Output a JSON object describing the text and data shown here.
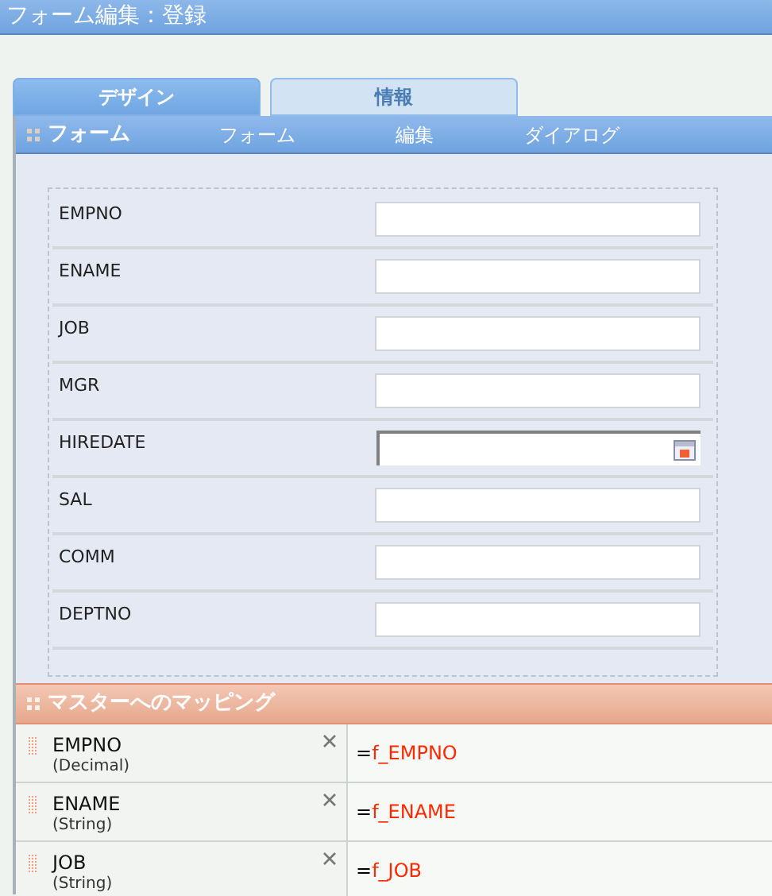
{
  "window": {
    "title": "フォーム編集：登録"
  },
  "tabs": [
    {
      "label": "デザイン",
      "selected": true
    },
    {
      "label": "情報",
      "selected": false
    }
  ],
  "form_panel": {
    "title": "フォーム",
    "menu": [
      "フォーム",
      "編集",
      "ダイアログ"
    ]
  },
  "fields": [
    {
      "label": "EMPNO",
      "kind": "text"
    },
    {
      "label": "ENAME",
      "kind": "text"
    },
    {
      "label": "JOB",
      "kind": "text"
    },
    {
      "label": "MGR",
      "kind": "text"
    },
    {
      "label": "HIREDATE",
      "kind": "date"
    },
    {
      "label": "SAL",
      "kind": "text"
    },
    {
      "label": "COMM",
      "kind": "text"
    },
    {
      "label": "DEPTNO",
      "kind": "text"
    }
  ],
  "mapping_panel": {
    "title": "マスターへのマッピング"
  },
  "mappings": [
    {
      "name": "EMPNO",
      "type": "(Decimal)",
      "expression": "=f_EMPNO"
    },
    {
      "name": "ENAME",
      "type": "(String)",
      "expression": "=f_ENAME"
    },
    {
      "name": "JOB",
      "type": "(String)",
      "expression": "=f_JOB"
    }
  ]
}
